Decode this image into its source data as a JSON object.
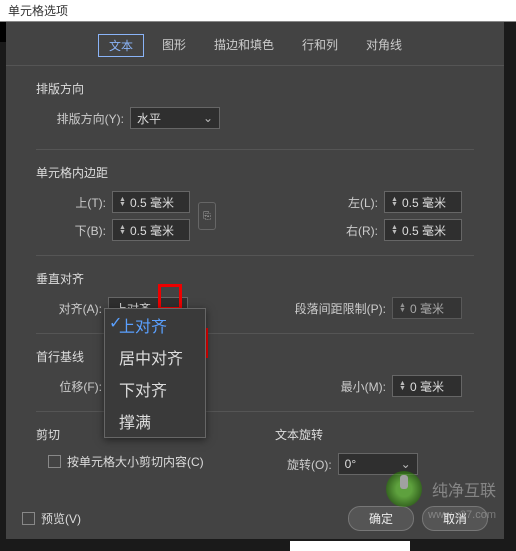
{
  "title": "单元格选项",
  "tabs": [
    "文本",
    "图形",
    "描边和填色",
    "行和列",
    "对角线"
  ],
  "active_tab": 0,
  "layout_direction": {
    "title": "排版方向",
    "label": "排版方向(Y):",
    "value": "水平"
  },
  "cell_padding": {
    "title": "单元格内边距",
    "top_label": "上(T):",
    "top_value": "0.5 毫米",
    "bottom_label": "下(B):",
    "bottom_value": "0.5 毫米",
    "left_label": "左(L):",
    "left_value": "0.5 毫米",
    "right_label": "右(R):",
    "right_value": "0.5 毫米"
  },
  "vertical_align": {
    "title": "垂直对齐",
    "align_label": "对齐(A):",
    "align_value": "上对齐",
    "spacing_label": "段落间距限制(P):",
    "spacing_value": "0 毫米",
    "options": [
      "上对齐",
      "居中对齐",
      "下对齐",
      "撑满"
    ],
    "selected_index": 0
  },
  "first_baseline": {
    "title": "首行基线",
    "offset_label": "位移(F):",
    "min_label": "最小(M):",
    "min_value": "0 毫米"
  },
  "clip": {
    "title": "剪切",
    "checkbox_label": "按单元格大小剪切内容(C)"
  },
  "text_rotation": {
    "title": "文本旋转",
    "label": "旋转(O):",
    "value": "0°"
  },
  "preview_label": "预览(V)",
  "ok_label": "确定",
  "cancel_label": "取消",
  "watermark": {
    "text": "纯净互联",
    "url": "www.x27.com"
  }
}
